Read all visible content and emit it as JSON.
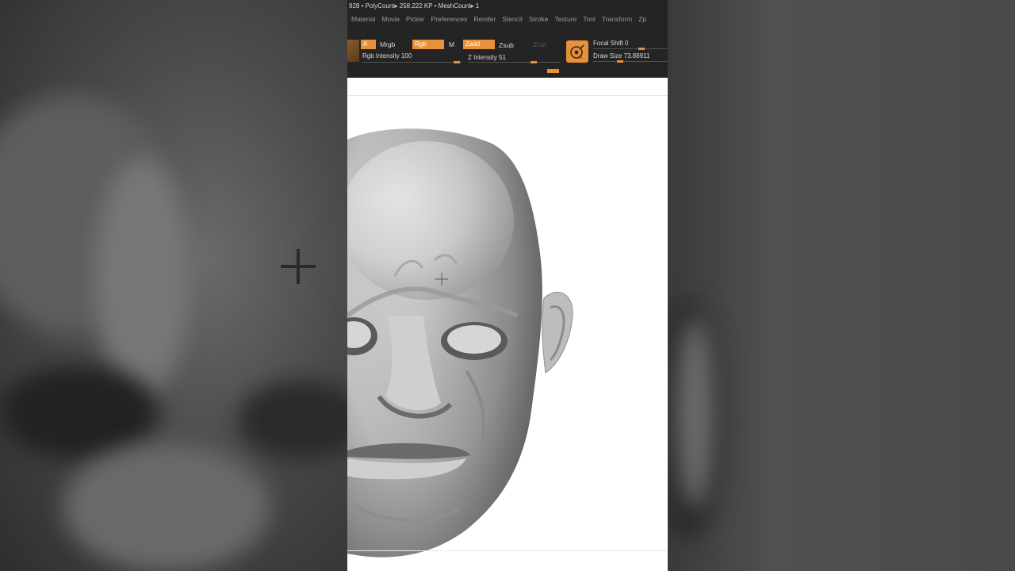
{
  "status_bar": {
    "text": "928 • PolyCount▸ 258.222 KP  • MeshCount▸ 1"
  },
  "menu": {
    "items": [
      "Material",
      "Movie",
      "Picker",
      "Preferences",
      "Render",
      "Stencil",
      "Stroke",
      "Texture",
      "Tool",
      "Transform",
      "Zp"
    ]
  },
  "palette": {
    "a_label": "A",
    "mrgb_label": "Mrgb",
    "rgb_label": "Rgb",
    "m_label": "M",
    "zadd_label": "Zadd",
    "zsub_label": "Zsub",
    "zcut_label": "Zcut",
    "rgb_intensity": "Rgb Intensity 100",
    "z_intensity": "Z Intensity 51",
    "focal_shift": "Focal Shift 0",
    "draw_size": "Draw Size 73.88911"
  },
  "values": {
    "rgb_intensity": 100,
    "z_intensity": 51,
    "focal_shift": 0,
    "draw_size": 73.88911
  },
  "colors": {
    "accent": "#e8913a",
    "toolbar_bg": "#242424",
    "canvas_bg": "#ffffff",
    "side_bg": "#474747"
  },
  "icons": {
    "focal": "focal-shift-icon",
    "cursor": "crosshair-cursor-icon"
  }
}
